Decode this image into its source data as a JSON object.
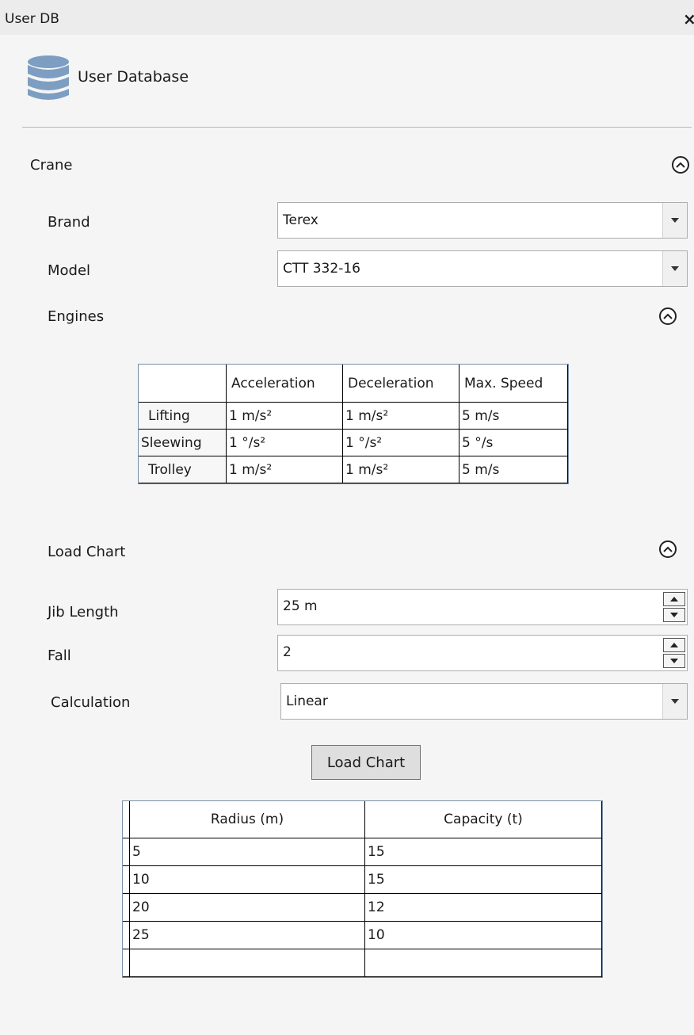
{
  "window": {
    "title": "User DB",
    "close_glyph": "×"
  },
  "header": {
    "title": "User Database",
    "icon": "database-icon"
  },
  "crane": {
    "label": "Crane",
    "brand": {
      "label": "Brand",
      "value": "Terex"
    },
    "model": {
      "label": "Model",
      "value": "CTT 332-16"
    },
    "engines": {
      "label": "Engines",
      "columns": [
        "Acceleration",
        "Deceleration",
        "Max. Speed"
      ],
      "rows": [
        {
          "name": "Lifting",
          "cells": [
            "1 m/s²",
            "1 m/s²",
            "5 m/s"
          ]
        },
        {
          "name": "Sleewing",
          "cells": [
            "1 °/s²",
            "1 °/s²",
            "5 °/s"
          ]
        },
        {
          "name": "Trolley",
          "cells": [
            "1 m/s²",
            "1 m/s²",
            "5 m/s"
          ]
        }
      ]
    }
  },
  "load_chart": {
    "label": "Load Chart",
    "jib_length": {
      "label": "Jib Length",
      "value": "25 m"
    },
    "fall": {
      "label": "Fall",
      "value": "2"
    },
    "calculation": {
      "label": "Calculation",
      "value": "Linear"
    },
    "button_label": "Load Chart",
    "columns": [
      "Radius (m)",
      "Capacity (t)"
    ],
    "rows": [
      [
        "5",
        "15"
      ],
      [
        "10",
        "15"
      ],
      [
        "20",
        "12"
      ],
      [
        "25",
        "10"
      ],
      [
        "",
        ""
      ]
    ]
  }
}
